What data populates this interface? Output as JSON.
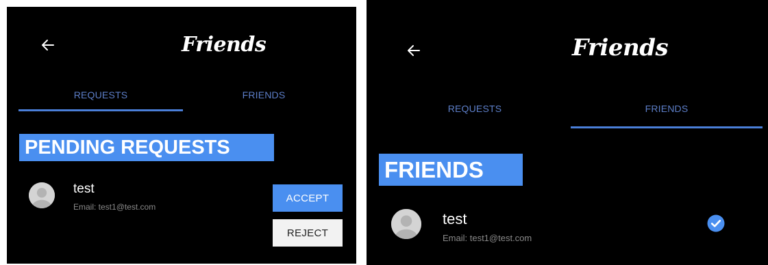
{
  "left": {
    "title": "Friends",
    "tabs": [
      {
        "label": "REQUESTS",
        "active": true
      },
      {
        "label": "FRIENDS",
        "active": false
      }
    ],
    "section_header": "PENDING REQUESTS",
    "request": {
      "name": "test",
      "email": "Email: test1@test.com",
      "accept_label": "ACCEPT",
      "reject_label": "REJECT"
    }
  },
  "right": {
    "title": "Friends",
    "tabs": [
      {
        "label": "REQUESTS",
        "active": false
      },
      {
        "label": "FRIENDS",
        "active": true
      }
    ],
    "section_header": "FRIENDS",
    "friend": {
      "name": "test",
      "email": "Email: test1@test.com"
    }
  },
  "icons": {
    "back": "arrow-left-icon",
    "avatar": "person-avatar-icon",
    "status": "check-circle-icon"
  },
  "colors": {
    "background": "#000000",
    "accent": "#4a8ff0",
    "tab_text": "#5d7fc9",
    "tab_indicator": "#4a7fd9",
    "email_text": "#8a8a8a",
    "reject_bg": "#f2f2f2"
  }
}
